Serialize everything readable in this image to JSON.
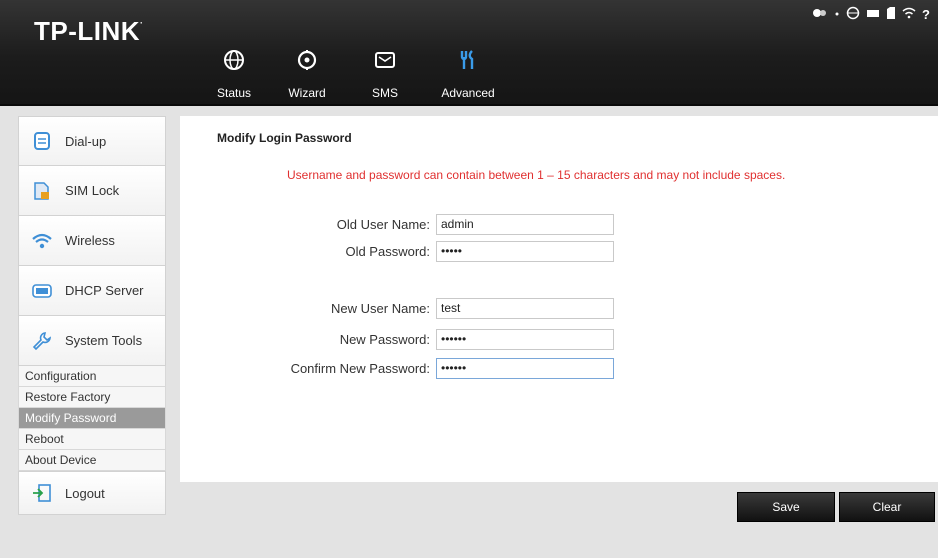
{
  "brand": {
    "logo_text": "TP-LINK",
    "logo_mark": "·"
  },
  "nav": [
    {
      "label": "Status",
      "icon": "globe-icon"
    },
    {
      "label": "Wizard",
      "icon": "target-icon"
    },
    {
      "label": "SMS",
      "icon": "envelope-icon"
    },
    {
      "label": "Advanced",
      "icon": "tools-icon"
    }
  ],
  "status_bar": {
    "icons": [
      "link-icon",
      "globe-status-icon",
      "battery-icon",
      "sim-icon",
      "wifi-signal-icon",
      "help-icon"
    ],
    "help": "?"
  },
  "sidebar": {
    "items": [
      {
        "label": "Dial-up",
        "icon": "dialup-icon"
      },
      {
        "label": "SIM Lock",
        "icon": "sim-lock-icon"
      },
      {
        "label": "Wireless",
        "icon": "wireless-icon"
      },
      {
        "label": "DHCP Server",
        "icon": "dhcp-icon"
      },
      {
        "label": "System Tools",
        "icon": "wrench-icon"
      }
    ],
    "sub_items": [
      "Configuration",
      "Restore Factory",
      "Modify Password",
      "Reboot",
      "About Device"
    ],
    "active_sub_item": "Modify Password",
    "logout": {
      "label": "Logout",
      "icon": "logout-icon"
    }
  },
  "content": {
    "title": "Modify Login Password",
    "note": "Username and password can contain between 1 – 15 characters and may not include spaces.",
    "fields": {
      "old_user": {
        "label": "Old User Name:",
        "value": "admin"
      },
      "old_password": {
        "label": "Old Password:",
        "value": "•••••"
      },
      "new_user": {
        "label": "New User Name:",
        "value": "test"
      },
      "new_password": {
        "label": "New Password:",
        "value": "••••••"
      },
      "confirm_password": {
        "label": "Confirm New Password:",
        "value": "••••••"
      }
    }
  },
  "buttons": {
    "save": "Save",
    "clear": "Clear"
  },
  "colors": {
    "note": "#e03030",
    "header_bg": "#1c1c1c",
    "nav_active": "#2f8fe0",
    "active_sub_bg": "#9a9a9a"
  }
}
